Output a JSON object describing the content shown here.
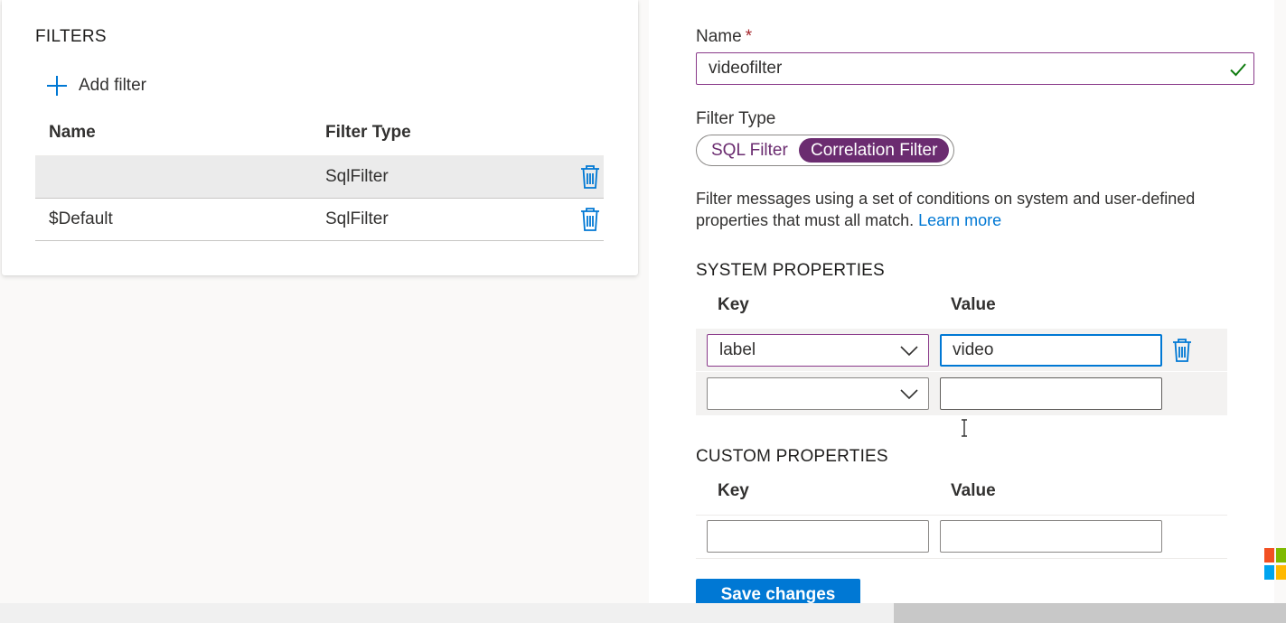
{
  "filters_panel": {
    "title": "FILTERS",
    "add_filter_label": "Add filter",
    "columns": {
      "name": "Name",
      "filter_type": "Filter Type"
    },
    "rows": [
      {
        "name": "",
        "filter_type": "SqlFilter"
      },
      {
        "name": "$Default",
        "filter_type": "SqlFilter"
      }
    ]
  },
  "editor": {
    "name_label": "Name",
    "required_marker": "*",
    "name_value": "videofilter",
    "filter_type_label": "Filter Type",
    "filter_type_options": [
      "SQL Filter",
      "Correlation Filter"
    ],
    "filter_type_selected": "Correlation Filter",
    "description": "Filter messages using a set of conditions on system and user-defined properties that must all match.",
    "learn_more": "Learn more",
    "system_properties": {
      "title": "SYSTEM PROPERTIES",
      "key_header": "Key",
      "value_header": "Value",
      "rows": [
        {
          "key": "label",
          "value": "video"
        },
        {
          "key": "",
          "value": ""
        }
      ]
    },
    "custom_properties": {
      "title": "CUSTOM PROPERTIES",
      "key_header": "Key",
      "value_header": "Value",
      "rows": [
        {
          "key": "",
          "value": ""
        }
      ]
    },
    "save_label": "Save changes"
  },
  "colors": {
    "accent_purple": "#6b2c70",
    "primary_blue": "#0078d4",
    "success_green": "#107c10",
    "selected_row": "#ebebeb"
  },
  "icons": {
    "add": "plus-icon",
    "delete": "trash-icon",
    "valid": "checkmark-icon",
    "dropdown": "chevron-down-icon"
  }
}
